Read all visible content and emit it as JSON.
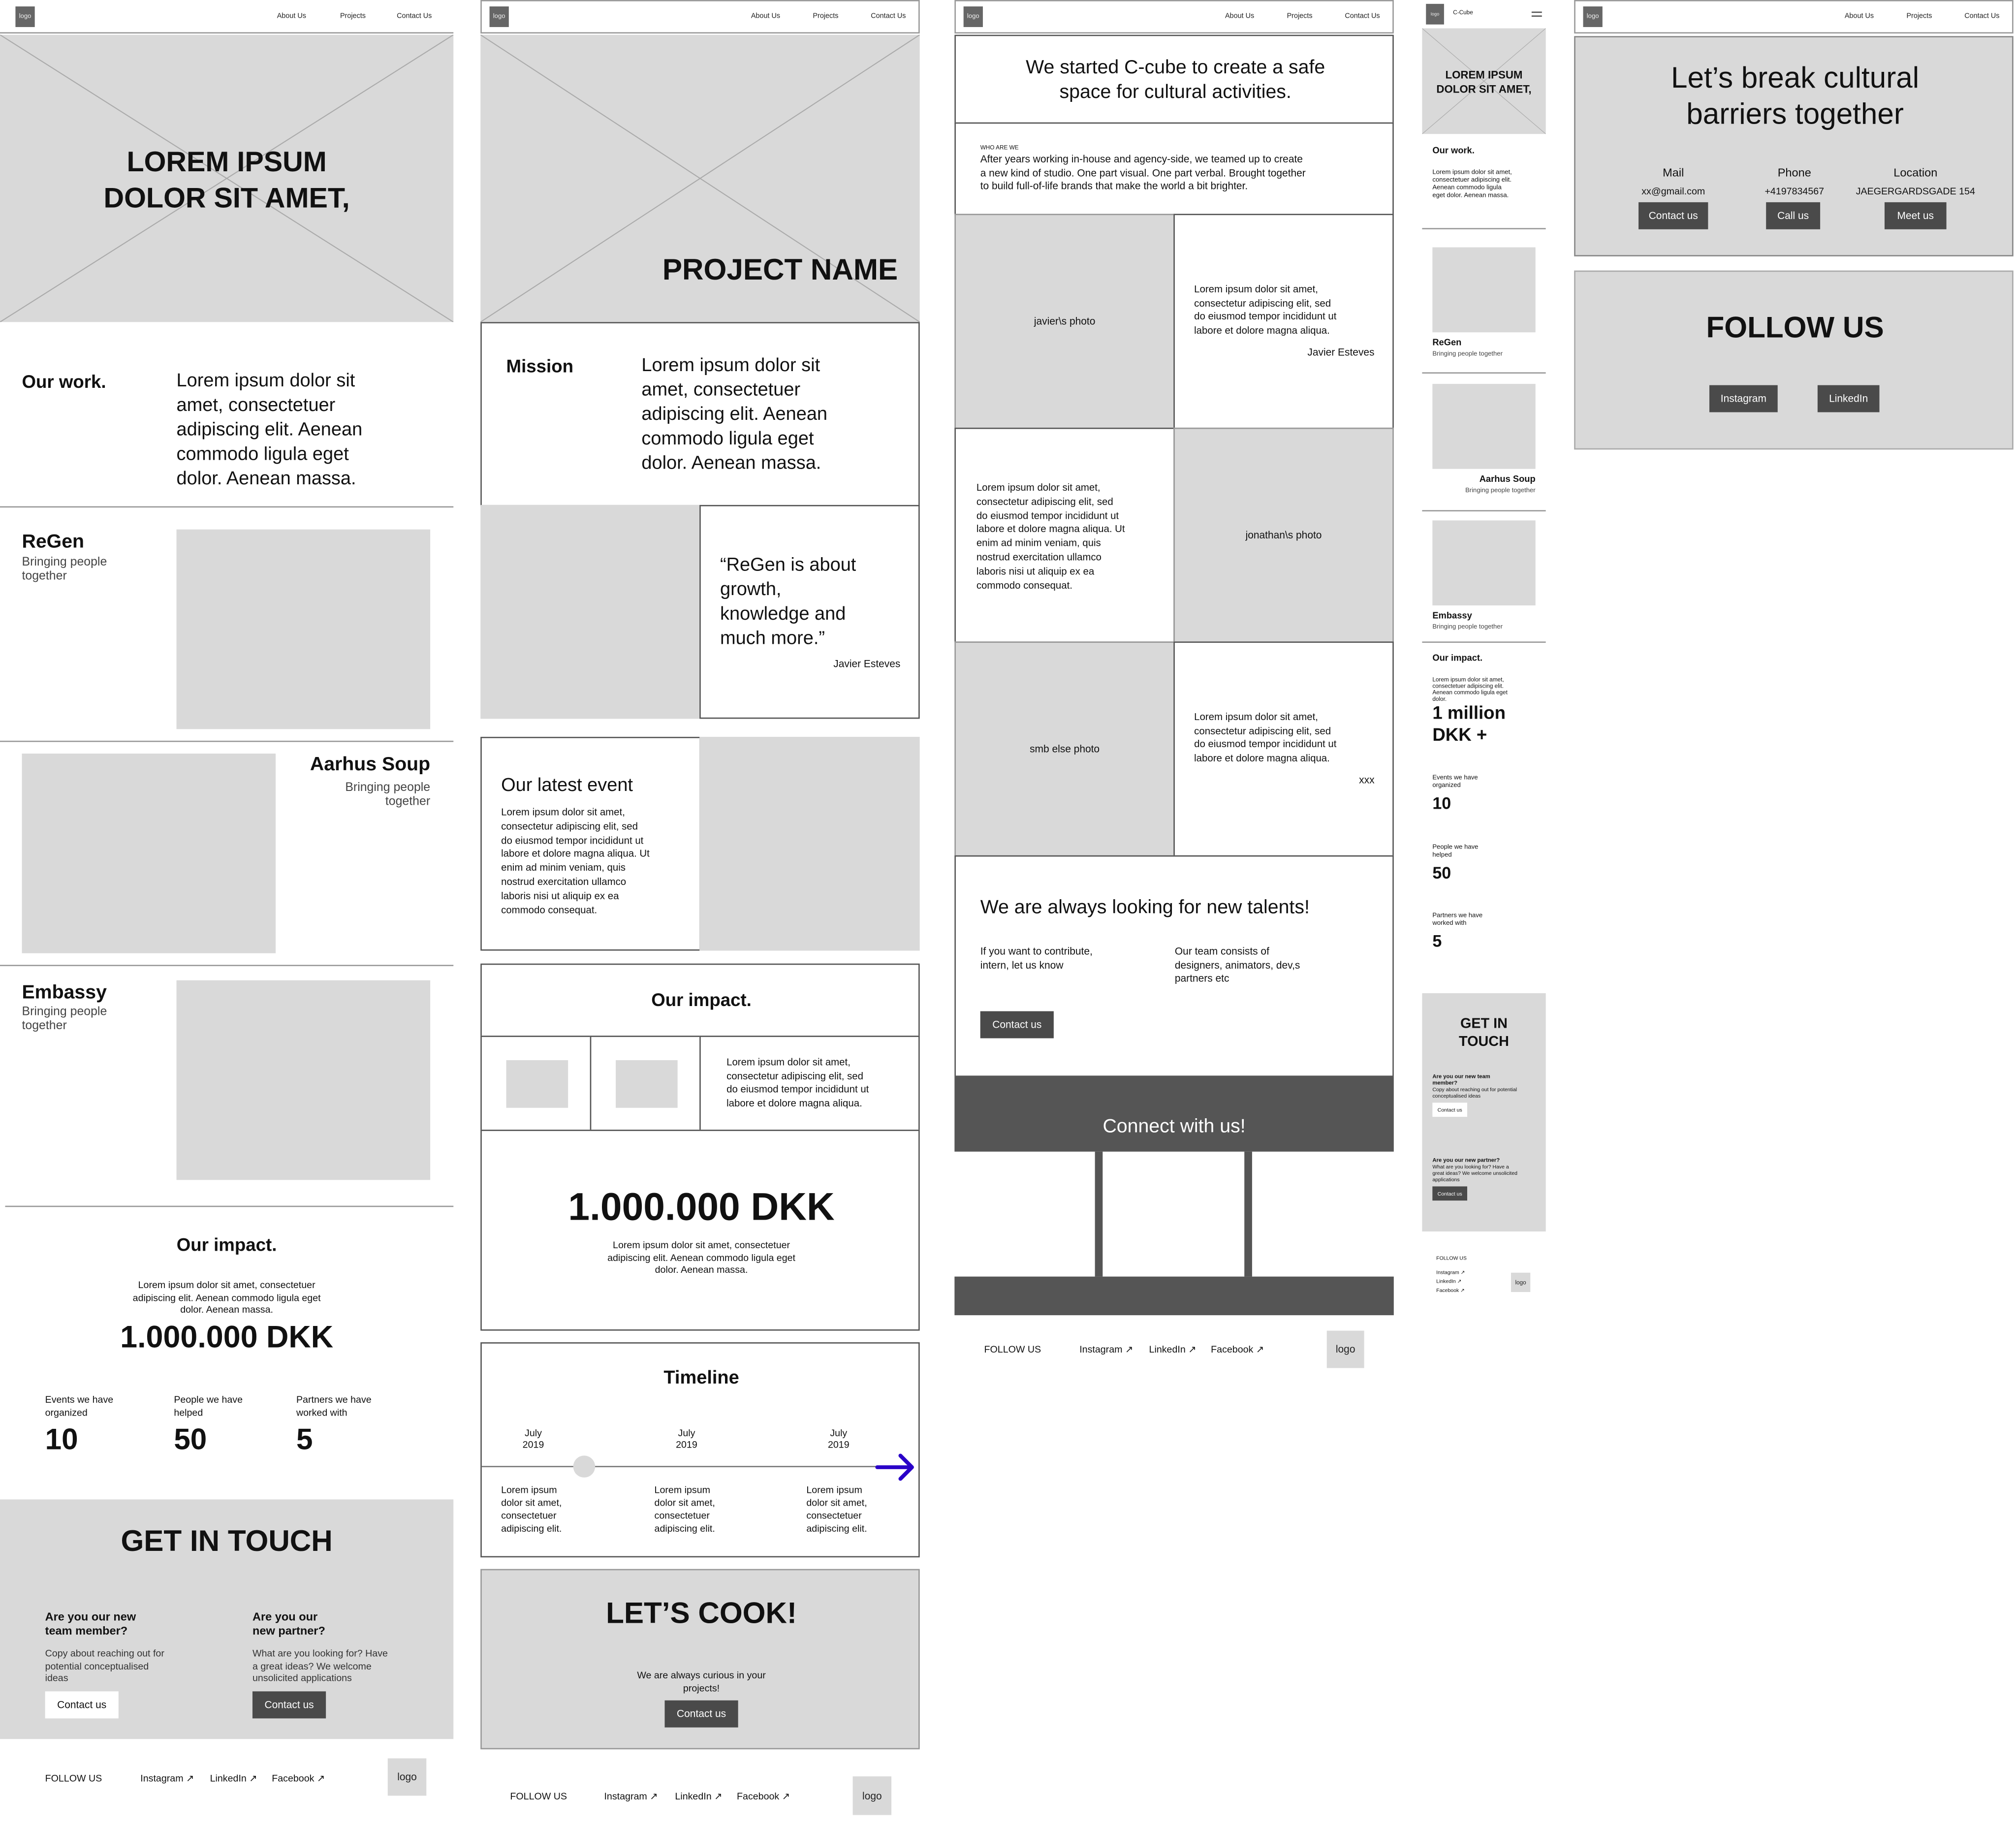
{
  "nav": {
    "logo": "logo",
    "about": "About Us",
    "projects": "Projects",
    "contact": "Contact Us"
  },
  "footer": {
    "follow": "FOLLOW US",
    "instagram": "Instagram ↗",
    "linkedin": "LinkedIn ↗",
    "facebook": "Facebook ↗",
    "logo": "logo"
  },
  "home": {
    "hero_title": "LOREM IPSUM\nDOLOR SIT AMET,",
    "work_label": "Our work.",
    "work_text": "Lorem ipsum dolor sit\namet, consectetuer\nadipiscing elit. Aenean\ncommodo ligula eget\ndolor. Aenean massa.",
    "projects": [
      {
        "title": "ReGen",
        "subtitle": "Bringing people\ntogether"
      },
      {
        "title": "Aarhus Soup",
        "subtitle": "Bringing people\ntogether"
      },
      {
        "title": "Embassy",
        "subtitle": "Bringing people\ntogether"
      }
    ],
    "impact_title": "Our impact.",
    "impact_text": "Lorem ipsum dolor sit amet, consectetuer\nadipiscing elit. Aenean commodo ligula eget\ndolor. Aenean massa.",
    "impact_amount": "1.000.000 DKK",
    "stats": [
      {
        "label": "Events we have\norganized",
        "value": "10"
      },
      {
        "label": "People we have\nhelped",
        "value": "50"
      },
      {
        "label": "Partners we have\nworked with",
        "value": "5"
      }
    ],
    "touch_title": "GET IN TOUCH",
    "touch": [
      {
        "heading": "Are you our new\nteam member?",
        "text": "Copy about reaching out for\npotential conceptualised\nideas",
        "button": "Contact us"
      },
      {
        "heading": "Are you our\nnew partner?",
        "text": "What are you looking for? Have\na great ideas? We welcome\nunsolicited applications",
        "button": "Contact us"
      }
    ]
  },
  "project": {
    "hero_title": "PROJECT NAME",
    "mission_label": "Mission",
    "mission_text": "Lorem ipsum dolor sit\namet, consectetuer\nadipiscing elit. Aenean\ncommodo ligula eget\ndolor. Aenean massa.",
    "quote": "“ReGen is about\ngrowth,\nknowledge and\nmuch more.”",
    "quote_author": "Javier Esteves",
    "event_title": "Our latest event",
    "event_text": "Lorem ipsum dolor sit amet,\nconsectetur adipiscing elit, sed\ndo eiusmod tempor incididunt ut\nlabore et dolore magna aliqua. Ut\nenim ad minim veniam, quis\nnostrud exercitation ullamco\nlaboris nisi ut aliquip ex ea\ncommodo consequat.",
    "impact_title": "Our impact.",
    "impact_text": "Lorem ipsum dolor sit amet,\nconsectetur adipiscing elit, sed\ndo eiusmod tempor incididunt ut\nlabore et dolore magna aliqua.",
    "amount": "1.000.000 DKK",
    "amount_text": "Lorem ipsum dolor sit amet, consectetuer\nadipiscing elit. Aenean commodo ligula eget\ndolor. Aenean massa.",
    "timeline_title": "Timeline",
    "timeline": [
      {
        "date": "July\n2019",
        "text": "Lorem ipsum\ndolor sit amet,\nconsectetuer\nadipiscing elit."
      },
      {
        "date": "July\n2019",
        "text": "Lorem ipsum\ndolor sit amet,\nconsectetuer\nadipiscing elit."
      },
      {
        "date": "July\n2019",
        "text": "Lorem ipsum\ndolor sit amet,\nconsectetuer\nadipiscing elit."
      }
    ],
    "arrow_color": "#2a00c8",
    "cook_title": "LET’S COOK!",
    "cook_text": "We are always curious in your\nprojects!",
    "cook_button": "Contact us"
  },
  "about": {
    "intro": "We started C-cube to create a safe\nspace for cultural activities.",
    "who_label": "WHO ARE WE",
    "who_text": "After years working in-house and agency-side, we teamed up to create\na new kind of studio. One part visual. One part verbal. Brought together\nto build full-of-life brands that make the world a bit brighter.",
    "rows": [
      {
        "photo": "javier\\s photo",
        "text": "Lorem ipsum dolor sit amet,\nconsectetur adipiscing elit, sed\ndo eiusmod tempor incididunt ut\nlabore et dolore magna aliqua.",
        "author": "Javier Esteves"
      },
      {
        "photo": "jonathan\\s photo",
        "text": "Lorem ipsum dolor sit amet,\nconsectetur adipiscing elit, sed\ndo eiusmod tempor incididunt ut\nlabore et dolore magna aliqua. Ut\nenim ad minim veniam, quis\nnostrud exercitation ullamco\nlaboris nisi ut aliquip ex ea\ncommodo consequat."
      },
      {
        "photo": "smb else photo",
        "text": "Lorem ipsum dolor sit amet,\nconsectetur adipiscing elit, sed\ndo eiusmod tempor incididunt ut\nlabore et dolore magna aliqua.",
        "author": "xxx"
      }
    ],
    "talents_title": "We are always looking for new talents!",
    "talents_left": "If you want to contribute,\nintern, let us know",
    "talents_right": "Our team consists of\ndesigners, animators, dev,s\npartners etc",
    "talents_button": "Contact us",
    "connect": "Connect with us!"
  },
  "mobile": {
    "brand": "C-Cube",
    "hero_title": "LOREM IPSUM\nDOLOR SIT AMET,",
    "work_label": "Our work.",
    "work_text": "Lorem ipsum dolor sit amet,\nconsectetuer adipiscing elit.\nAenean commodo ligula\neget dolor. Aenean massa.",
    "projects": [
      {
        "title": "ReGen",
        "subtitle": "Bringing people together"
      },
      {
        "title": "Aarhus Soup",
        "subtitle": "Bringing people together"
      },
      {
        "title": "Embassy",
        "subtitle": "Bringing people together"
      }
    ],
    "impact_title": "Our impact.",
    "impact_text": "Lorem ipsum dolor sit amet,\nconsectetuer adipiscing elit.\nAenean commodo ligula eget\ndolor.",
    "amount": "1 million\nDKK +",
    "stats": [
      {
        "label": "Events we have\norganized",
        "value": "10"
      },
      {
        "label": "People we have\nhelped",
        "value": "50"
      },
      {
        "label": "Partners we have\nworked with",
        "value": "5"
      }
    ],
    "touch_title": "GET IN\nTOUCH",
    "touch": [
      {
        "heading": "Are you our new team\nmember?",
        "text": "Copy about reaching out for potential\nconceptualised ideas",
        "button": "Contact us"
      },
      {
        "heading": "Are you our new partner?",
        "text": "What are you looking for? Have a\ngreat ideas? We welcome unsolicited\napplications",
        "button": "Contact us"
      }
    ]
  },
  "contact": {
    "title": "Let’s break cultural\nbarriers together",
    "columns": [
      {
        "heading": "Mail",
        "value": "xx@gmail.com",
        "button": "Contact us"
      },
      {
        "heading": "Phone",
        "value": "+4197834567",
        "button": "Call us"
      },
      {
        "heading": "Location",
        "value": "JAEGERGARDSGADE 154",
        "button": "Meet us"
      }
    ],
    "follow_title": "FOLLOW US",
    "instagram": "Instagram",
    "linkedin": "LinkedIn"
  }
}
